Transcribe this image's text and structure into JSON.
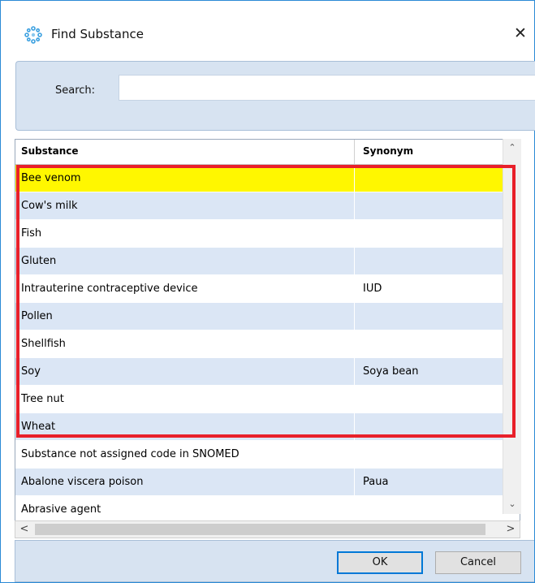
{
  "window": {
    "title": "Find Substance",
    "icon": "atom-spinner-icon",
    "close_label": "✕"
  },
  "search": {
    "label": "Search:",
    "value": "",
    "placeholder": ""
  },
  "grid": {
    "columns": [
      "Substance",
      "Synonym"
    ],
    "rows": [
      {
        "substance": "Bee venom",
        "synonym": "",
        "selected": true
      },
      {
        "substance": "Cow's milk",
        "synonym": ""
      },
      {
        "substance": "Fish",
        "synonym": ""
      },
      {
        "substance": "Gluten",
        "synonym": ""
      },
      {
        "substance": "Intrauterine contraceptive device",
        "synonym": "IUD"
      },
      {
        "substance": "Pollen",
        "synonym": ""
      },
      {
        "substance": "Shellfish",
        "synonym": ""
      },
      {
        "substance": "Soy",
        "synonym": "Soya bean"
      },
      {
        "substance": "Tree nut",
        "synonym": ""
      },
      {
        "substance": "Wheat",
        "synonym": ""
      },
      {
        "substance": "Substance not assigned code in SNOMED",
        "synonym": ""
      },
      {
        "substance": "Abalone viscera poison",
        "synonym": "Paua"
      },
      {
        "substance": "Abrasive agent",
        "synonym": ""
      }
    ]
  },
  "scrollbars": {
    "up": "⌃",
    "down": "⌄",
    "left": "<",
    "right": ">"
  },
  "buttons": {
    "ok": "OK",
    "cancel": "Cancel"
  },
  "colors": {
    "selected_row": "#fff700",
    "alt_row": "#dbe6f5",
    "highlight_box": "#e8202a",
    "accent": "#2b8ad6"
  }
}
